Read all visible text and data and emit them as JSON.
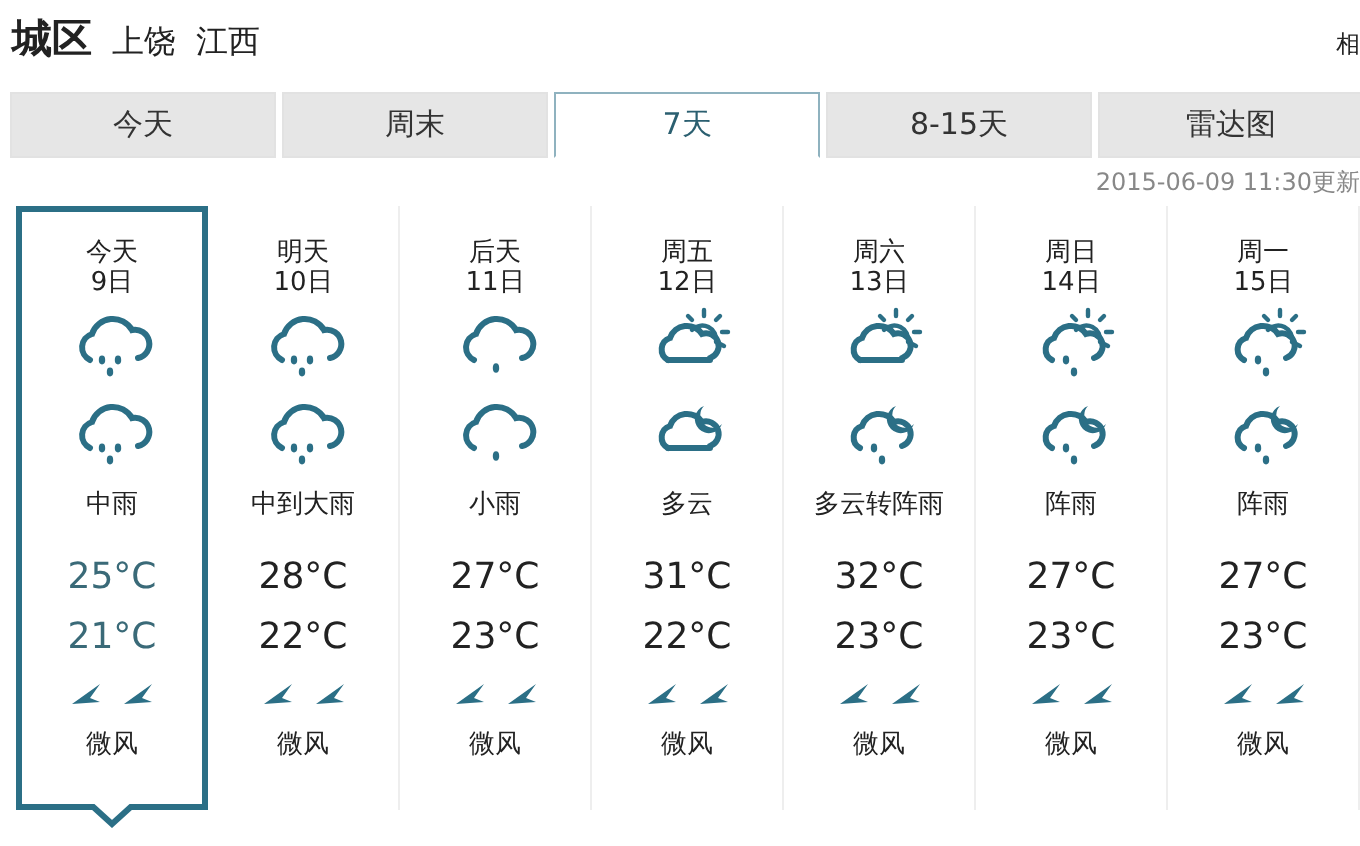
{
  "header": {
    "district": "城区",
    "city": "上饶",
    "province": "江西",
    "corner_text": "相"
  },
  "tabs": [
    {
      "label": "今天",
      "selected": false
    },
    {
      "label": "周末",
      "selected": false
    },
    {
      "label": "7天",
      "selected": true
    },
    {
      "label": "8-15天",
      "selected": false
    },
    {
      "label": "雷达图",
      "selected": false
    }
  ],
  "updated": "2015-06-09 11:30更新",
  "days": [
    {
      "day": "今天",
      "date": "9日",
      "icons": [
        {
          "kind": "rain-moderate"
        },
        {
          "kind": "rain-moderate"
        }
      ],
      "weather": "中雨",
      "high": "25°C",
      "low": "21°C",
      "wind": "微风",
      "selected": true
    },
    {
      "day": "明天",
      "date": "10日",
      "icons": [
        {
          "kind": "rain-moderate"
        },
        {
          "kind": "rain-moderate"
        }
      ],
      "weather": "中到大雨",
      "high": "28°C",
      "low": "22°C",
      "wind": "微风",
      "selected": false
    },
    {
      "day": "后天",
      "date": "11日",
      "icons": [
        {
          "kind": "rain-light"
        },
        {
          "kind": "rain-light"
        }
      ],
      "weather": "小雨",
      "high": "27°C",
      "low": "23°C",
      "wind": "微风",
      "selected": false
    },
    {
      "day": "周五",
      "date": "12日",
      "icons": [
        {
          "kind": "sun-cloud"
        },
        {
          "kind": "moon-cloud"
        }
      ],
      "weather": "多云",
      "high": "31°C",
      "low": "22°C",
      "wind": "微风",
      "selected": false
    },
    {
      "day": "周六",
      "date": "13日",
      "icons": [
        {
          "kind": "sun-cloud"
        },
        {
          "kind": "moon-cloud-rain"
        }
      ],
      "weather": "多云转阵雨",
      "high": "32°C",
      "low": "23°C",
      "wind": "微风",
      "selected": false
    },
    {
      "day": "周日",
      "date": "14日",
      "icons": [
        {
          "kind": "sun-cloud-rain"
        },
        {
          "kind": "moon-cloud-rain"
        }
      ],
      "weather": "阵雨",
      "high": "27°C",
      "low": "23°C",
      "wind": "微风",
      "selected": false
    },
    {
      "day": "周一",
      "date": "15日",
      "icons": [
        {
          "kind": "sun-cloud-rain"
        },
        {
          "kind": "moon-cloud-rain"
        }
      ],
      "weather": "阵雨",
      "high": "27°C",
      "low": "23°C",
      "wind": "微风",
      "selected": false
    }
  ]
}
